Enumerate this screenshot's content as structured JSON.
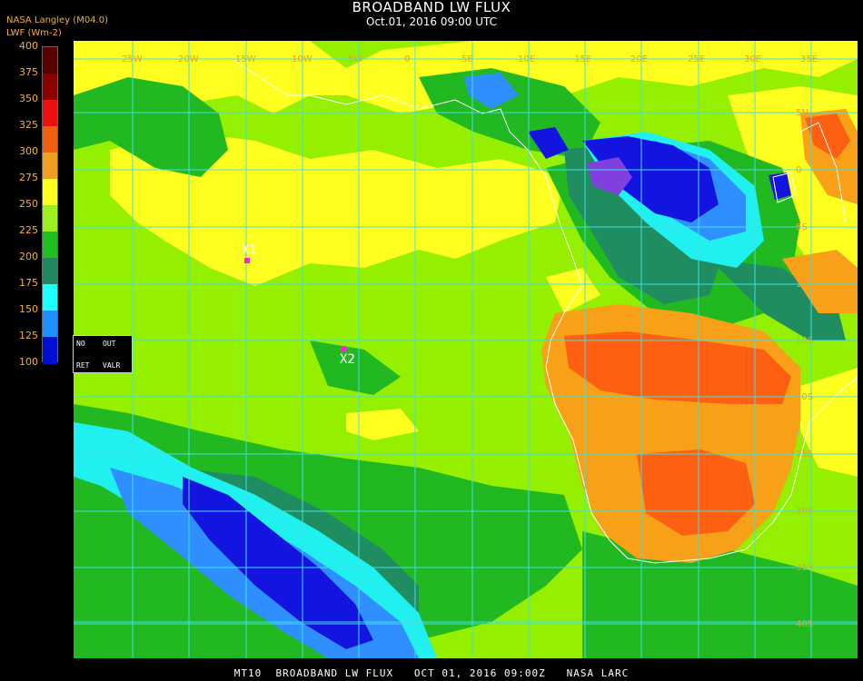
{
  "header": {
    "title": "BROADBAND LW FLUX",
    "subtitle": "Oct.01, 2016 09:00 UTC",
    "producer": "NASA Langley (M04.0)",
    "unit": "LWF (Wm-2)"
  },
  "legend": {
    "levels": [
      "400",
      "375",
      "350",
      "325",
      "300",
      "275",
      "250",
      "225",
      "200",
      "175",
      "150",
      "125",
      "100"
    ],
    "colors": [
      "#5a0000",
      "#8c0000",
      "#ee1010",
      "#f06010",
      "#f0a020",
      "#ffff20",
      "#9cf020",
      "#20c020",
      "#208860",
      "#20ffff",
      "#2090ff",
      "#0010d0",
      "#8040e0"
    ]
  },
  "map": {
    "colors": {
      "green": "#94ef00",
      "yellow": "#ffff20",
      "dark_green": "#22b822",
      "teal": "#1f8d5f",
      "cyan": "#20f0f0",
      "light_blue": "#2f8fff",
      "blue": "#1414e0",
      "purple": "#8040e0",
      "orange": "#f8a018",
      "red_orange": "#ff5f10",
      "grid": "#40e0e0",
      "coast": "#ffffff"
    },
    "lon_labels": [
      "25W",
      "20W",
      "15W",
      "10W",
      "5W",
      "0",
      "5E",
      "10E",
      "15E",
      "20E",
      "25E",
      "30E",
      "35E"
    ],
    "lat_labels": [
      "5N",
      "0",
      "5S",
      "10S",
      "15S",
      "20S",
      "25S",
      "30S",
      "35S",
      "40S"
    ],
    "markers": [
      {
        "label": "X1"
      },
      {
        "label": "X2"
      }
    ]
  },
  "controls": {
    "no": "NO",
    "out": "OUT",
    "ret": "RET",
    "valr": "VALR"
  },
  "footer": {
    "text": "MT10  BROADBAND LW FLUX   OCT 01, 2016 09:00Z   NASA LARC"
  }
}
